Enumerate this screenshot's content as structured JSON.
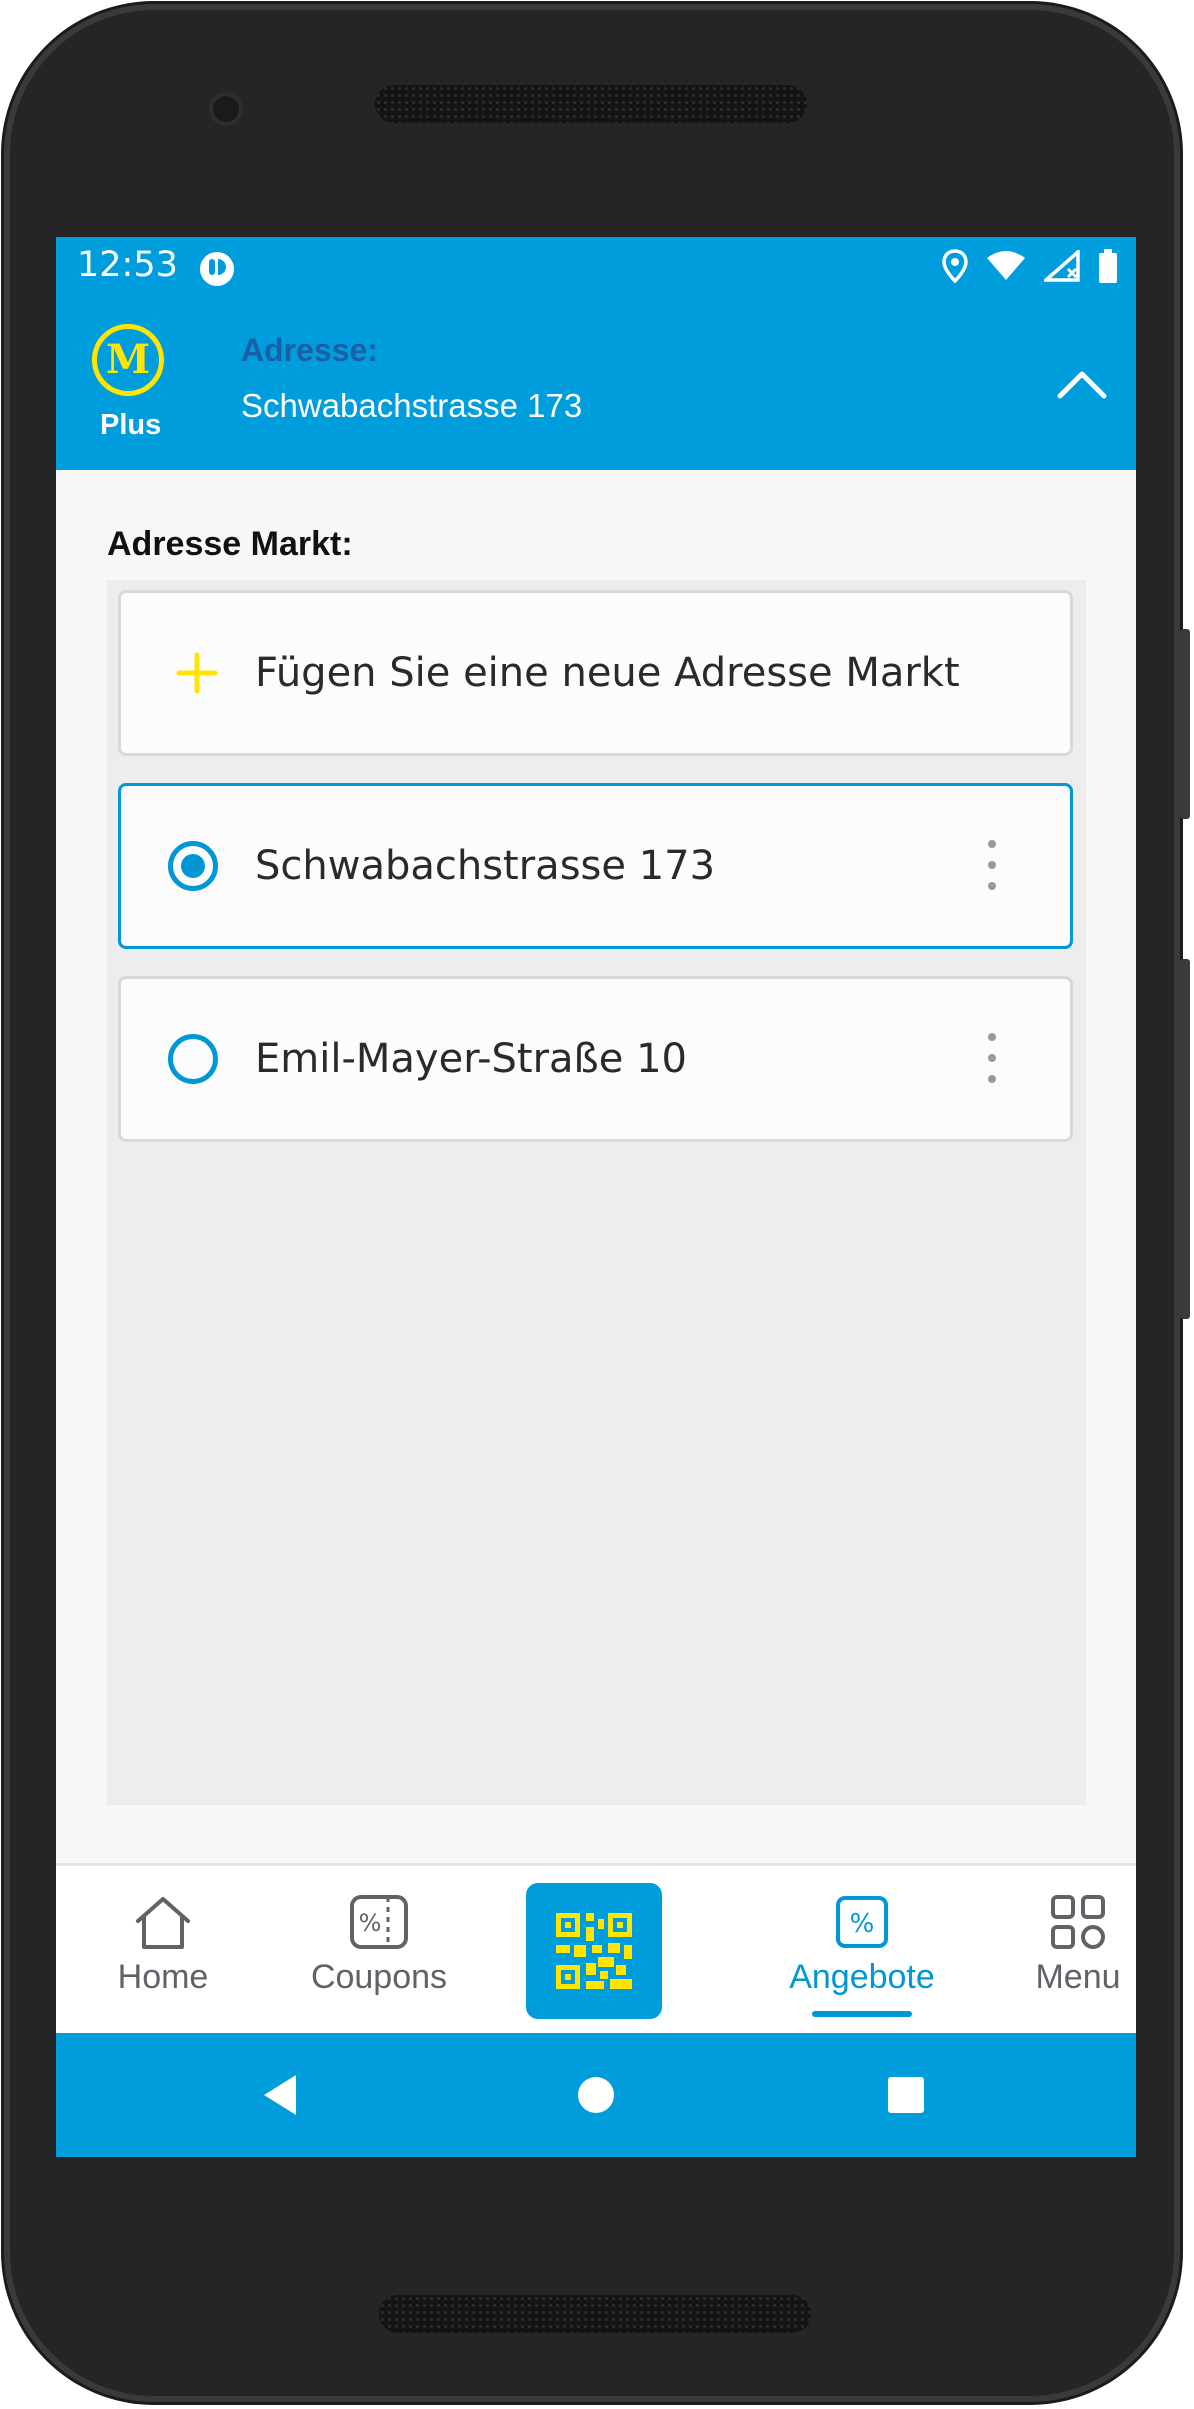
{
  "status_bar": {
    "time": "12:53",
    "icons": [
      "app-notification-icon",
      "location-icon",
      "wifi-icon",
      "signal-icon",
      "battery-icon"
    ]
  },
  "header": {
    "logo_letter": "M",
    "logo_sub": "Plus",
    "address_label": "Adresse:",
    "address_value": "Schwabachstrasse 173",
    "collapse_icon": "chevron-up-icon"
  },
  "content": {
    "section_title": "Adresse Markt:",
    "add_label": "Fügen Sie eine neue Adresse Markt",
    "addresses": [
      {
        "label": "Schwabachstrasse 173",
        "selected": true
      },
      {
        "label": "Emil-Mayer-Straße 10",
        "selected": false
      }
    ]
  },
  "bottom_nav": {
    "items": [
      {
        "label": "Home",
        "icon": "home-icon",
        "active": false
      },
      {
        "label": "Coupons",
        "icon": "coupon-icon",
        "active": false
      },
      {
        "label": "",
        "icon": "qr-code-icon",
        "active": false
      },
      {
        "label": "Angebote",
        "icon": "percent-tag-icon",
        "active": true
      },
      {
        "label": "Menu",
        "icon": "grid-menu-icon",
        "active": false
      }
    ]
  },
  "colors": {
    "primary": "#009ddd",
    "accent_yellow": "#ffe500",
    "address_label": "#1a5fa8",
    "selected_border": "#0097d6"
  }
}
